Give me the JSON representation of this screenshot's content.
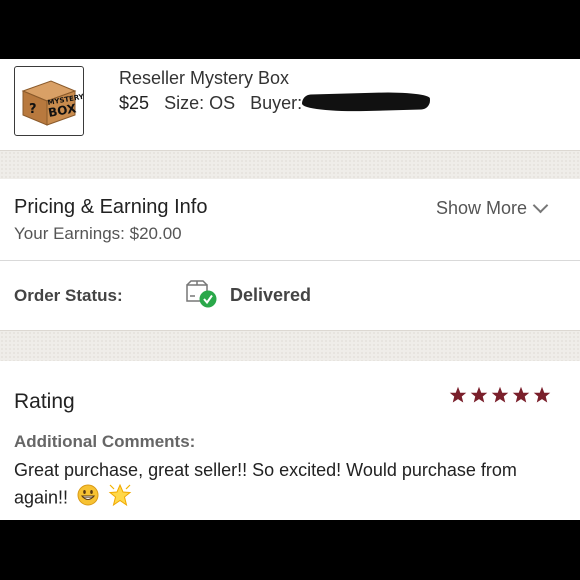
{
  "item": {
    "title": "Reseller Mystery Box",
    "price": "$25",
    "size": "Size: OS",
    "buyer_label": "Buyer:",
    "thumbnail_text": [
      "MYSTERY",
      "BOX"
    ],
    "thumbnail_mark": "?"
  },
  "pricing": {
    "title": "Pricing & Earning Info",
    "earnings": "Your Earnings: $20.00",
    "show_more": "Show More"
  },
  "status": {
    "label": "Order Status:",
    "value": "Delivered",
    "icon": "box-delivered-icon"
  },
  "rating": {
    "title": "Rating",
    "stars": 5,
    "star_color": "#7a1f2b",
    "comments_label": "Additional Comments:",
    "comments_text": "Great purchase, great seller!! So excited! Would purchase from again!!",
    "emojis": [
      "grinning-face-emoji",
      "glowing-star-emoji"
    ]
  },
  "colors": {
    "accent_green": "#2aa84a",
    "band": "#efede9"
  }
}
